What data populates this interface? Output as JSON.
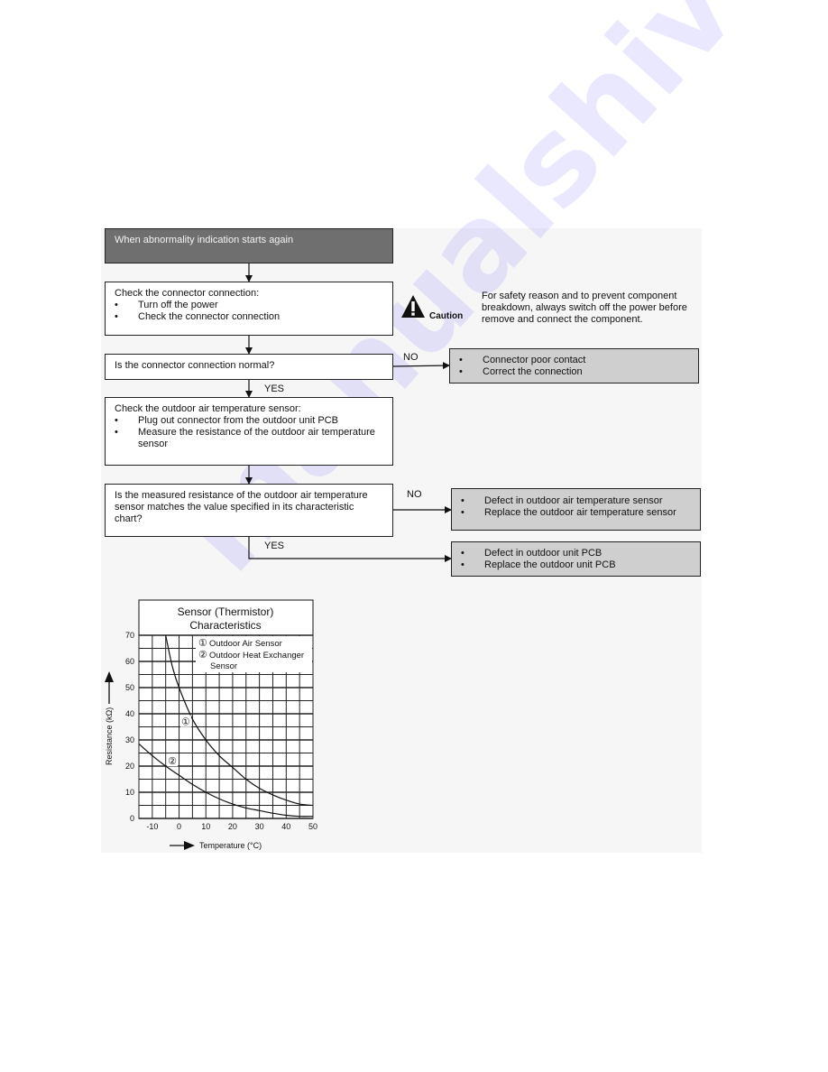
{
  "flowchart": {
    "start": "When abnormality indication starts again",
    "step1": {
      "title": "Check the connector connection:",
      "bullets": [
        "Turn off the power",
        "Check the connector connection"
      ]
    },
    "caution": {
      "icon": "warning-triangle-icon",
      "label": "Caution",
      "text": "For safety reason and to prevent component breakdown, always switch off the power before remove and connect the component."
    },
    "decision1": "Is the connector connection normal?",
    "decision1_no_label": "NO",
    "decision1_yes_label": "YES",
    "result1": {
      "bullets": [
        "Connector poor contact",
        "Correct the connection"
      ]
    },
    "step2": {
      "title": "Check the outdoor air temperature sensor:",
      "bullets": [
        "Plug out connector from the outdoor unit PCB",
        "Measure the resistance of the outdoor air temperature sensor"
      ]
    },
    "decision2": "Is the measured resistance of the outdoor air temperature sensor matches the value specified in its characteristic chart?",
    "decision2_no_label": "NO",
    "decision2_yes_label": "YES",
    "result2": {
      "bullets": [
        "Defect in outdoor air temperature sensor",
        "Replace the outdoor air temperature sensor"
      ]
    },
    "result3": {
      "bullets": [
        "Defect in outdoor unit PCB",
        "Replace the outdoor unit PCB"
      ]
    }
  },
  "watermark": "manualshive.com",
  "chart_data": {
    "type": "line",
    "title": "Sensor (Thermistor) Characteristics",
    "title_lines": [
      "Sensor (Thermistor)",
      "Characteristics"
    ],
    "xlabel": "Temperature (°C)",
    "ylabel": "Resistance (kΩ)",
    "xlim": [
      -15,
      50
    ],
    "ylim": [
      0,
      70
    ],
    "xticks": [
      -10,
      0,
      10,
      20,
      30,
      40,
      50
    ],
    "yticks": [
      0,
      10,
      20,
      30,
      40,
      50,
      60,
      70
    ],
    "grid": true,
    "grid_step": {
      "x": 5,
      "y": 5
    },
    "legend_placement": "top-right",
    "legend": [
      {
        "marker": "①",
        "text": "Outdoor Air Sensor"
      },
      {
        "marker": "②",
        "text": "Outdoor Heat Exchanger",
        "text2": "Sensor"
      }
    ],
    "series": [
      {
        "name": "Outdoor Air Sensor",
        "marker": "①",
        "x": [
          -5,
          -2.5,
          0,
          5,
          10,
          15,
          20,
          25,
          30,
          35,
          40,
          45,
          50
        ],
        "values": [
          70,
          58,
          50,
          38,
          30,
          24,
          19.5,
          15,
          11.5,
          9,
          7,
          5.5,
          5
        ]
      },
      {
        "name": "Outdoor Heat Exchanger Sensor",
        "marker": "②",
        "x": [
          -15,
          -10,
          -5,
          0,
          5,
          10,
          15,
          20,
          25,
          30,
          35,
          40,
          45,
          50
        ],
        "values": [
          28.5,
          24,
          20,
          16.5,
          13,
          10,
          7.5,
          5.5,
          4,
          3,
          2,
          1.2,
          0.8,
          0.8
        ]
      }
    ],
    "annotations": [
      {
        "text": "①",
        "x": 2.5,
        "y": 37
      },
      {
        "text": "②",
        "x": -2.5,
        "y": 22
      }
    ]
  }
}
